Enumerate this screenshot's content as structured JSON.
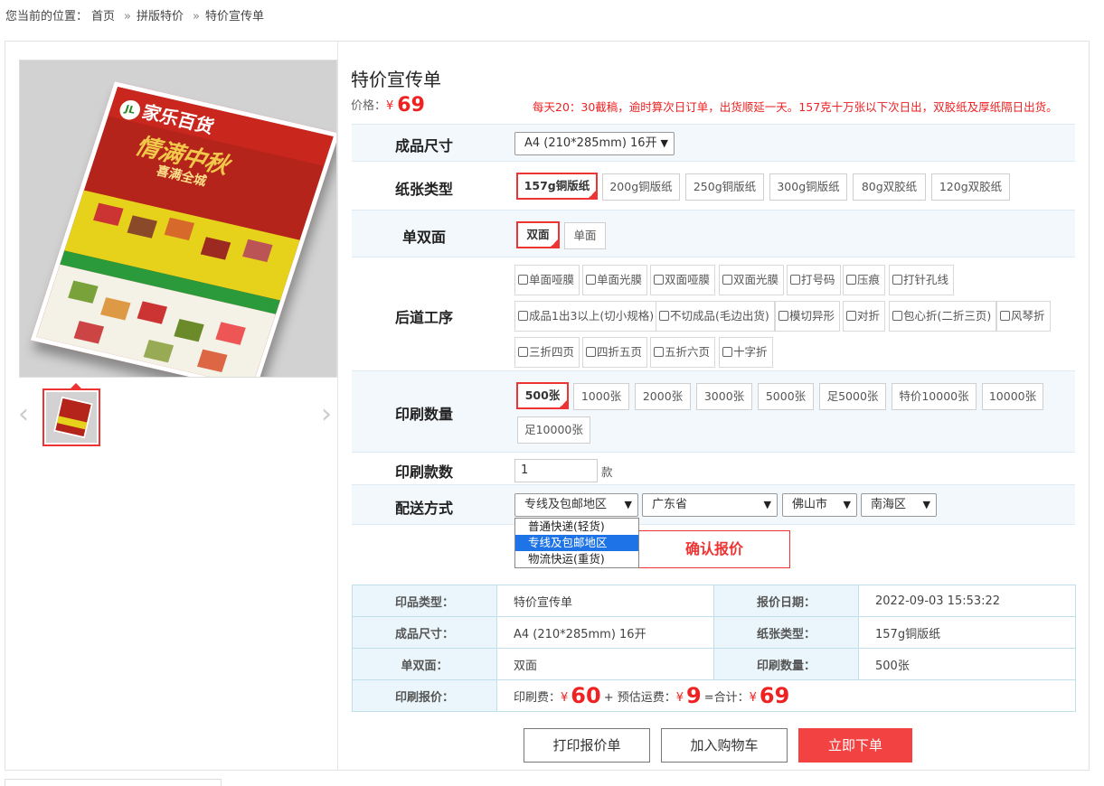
{
  "breadcrumb": {
    "prefix": "您当前的位置：",
    "home": "首页",
    "sep": "»",
    "category": "拼版特价",
    "current": "特价宣传单"
  },
  "product": {
    "title": "特价宣传单",
    "price_label": "价格：",
    "currency": "¥",
    "price": "69",
    "notice": "每天20：30截稿，逾时算次日订单，出货顺延一天。157克十万张以下次日出，双胶纸及厚纸隔日出货。"
  },
  "gallery": {
    "main_image": "flyer-mockup",
    "poster_brand": "家乐百货",
    "poster_logo": "JL",
    "poster_headline": "情满中秋",
    "poster_sub": "喜满全城"
  },
  "options": {
    "size": {
      "label": "成品尺寸",
      "value": "A4 (210*285mm) 16开"
    },
    "paper": {
      "label": "纸张类型",
      "items": [
        "157g铜版纸",
        "200g铜版纸",
        "250g铜版纸",
        "300g铜版纸",
        "80g双胶纸",
        "120g双胶纸"
      ],
      "selected": "157g铜版纸"
    },
    "sides": {
      "label": "单双面",
      "items": [
        "双面",
        "单面"
      ],
      "selected": "双面"
    },
    "finishing": {
      "label": "后道工序",
      "items": [
        "单面哑膜",
        "单面光膜",
        "双面哑膜",
        "双面光膜",
        "打号码",
        "压痕",
        "打针孔线",
        "成品1出3以上(切小规格)",
        "不切成品(毛边出货)",
        "模切异形",
        "对折",
        "包心折(二折三页)",
        "风琴折",
        "三折四页",
        "四折五页",
        "五折六页",
        "十字折"
      ]
    },
    "quantity": {
      "label": "印刷数量",
      "items": [
        "500张",
        "1000张",
        "2000张",
        "3000张",
        "5000张",
        "足5000张",
        "特价10000张",
        "10000张",
        "足10000张"
      ],
      "selected": "500张"
    },
    "copies": {
      "label": "印刷款数",
      "value": "1",
      "unit": "款"
    },
    "delivery": {
      "label": "配送方式",
      "method": "专线及包邮地区",
      "province": "广东省",
      "city": "佛山市",
      "district": "南海区",
      "dropdown": [
        "普通快递(轻货)",
        "专线及包邮地区",
        "物流快运(重货)"
      ],
      "highlighted": "专线及包邮地区"
    }
  },
  "confirm_label": "确认报价",
  "summary": {
    "k_type": "印品类型：",
    "v_type": "特价宣传单",
    "k_date": "报价日期：",
    "v_date": "2022-09-03 15:53:22",
    "k_size": "成品尺寸：",
    "v_size": "A4 (210*285mm) 16开",
    "k_paper": "纸张类型：",
    "v_paper": "157g铜版纸",
    "k_sides": "单双面：",
    "v_sides": "双面",
    "k_qty": "印刷数量：",
    "v_qty": "500张",
    "k_quote": "印刷报价：",
    "print_fee_label": "印刷费：",
    "print_fee": "60",
    "plus_ship_label": "+ 预估运费：",
    "ship_fee": "9",
    "total_label": "=合计：",
    "total": "69",
    "currency": "¥"
  },
  "actions": {
    "print_quote": "打印报价单",
    "add_cart": "加入购物车",
    "order_now": "立即下单"
  },
  "colors": {
    "accent": "#e33333",
    "row_shade": "#f3f8fc",
    "table_key_bg": "#eaf6fb",
    "dropdown_highlight": "#1e74e6"
  }
}
